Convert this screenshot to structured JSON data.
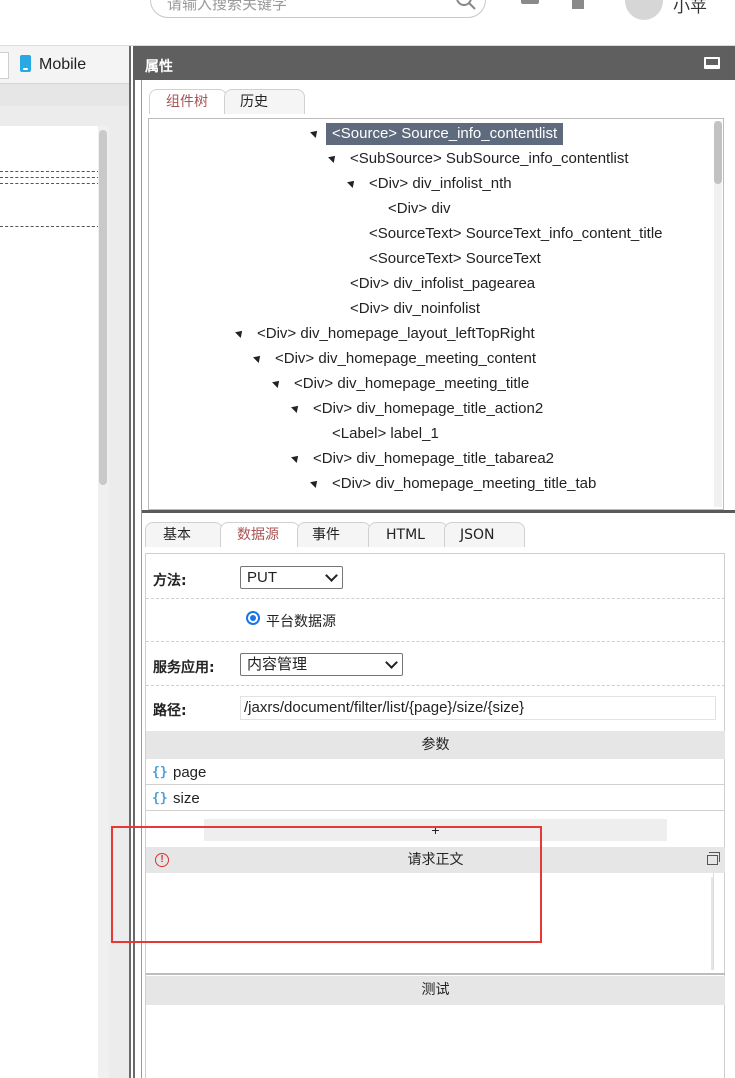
{
  "topbar": {
    "search_placeholder": "请输入搜索关键字",
    "username": "小苹"
  },
  "left_pane": {
    "device_tab": "Mobile"
  },
  "panel": {
    "title": "属性",
    "top_tabs": [
      "组件树",
      "历史"
    ],
    "active_top_tab": "组件树",
    "tree": [
      {
        "tag": "<Source>",
        "name": "Source_info_contentlist",
        "expanded": true,
        "selected": true
      },
      {
        "tag": "<SubSource>",
        "name": "SubSource_info_contentlist",
        "expanded": true
      },
      {
        "tag": "<Div>",
        "name": "div_infolist_nth",
        "expanded": true
      },
      {
        "tag": "<Div>",
        "name": "div"
      },
      {
        "tag": "<SourceText>",
        "name": "SourceText_info_content_title"
      },
      {
        "tag": "<SourceText>",
        "name": "SourceText"
      },
      {
        "tag": "<Div>",
        "name": "div_infolist_pagearea"
      },
      {
        "tag": "<Div>",
        "name": "div_noinfolist"
      },
      {
        "tag": "<Div>",
        "name": "div_homepage_layout_leftTopRight",
        "expanded": true
      },
      {
        "tag": "<Div>",
        "name": "div_homepage_meeting_content",
        "expanded": true
      },
      {
        "tag": "<Div>",
        "name": "div_homepage_meeting_title",
        "expanded": true
      },
      {
        "tag": "<Div>",
        "name": "div_homepage_title_action2",
        "expanded": true
      },
      {
        "tag": "<Label>",
        "name": "label_1"
      },
      {
        "tag": "<Div>",
        "name": "div_homepage_title_tabarea2",
        "expanded": true
      },
      {
        "tag": "<Div>",
        "name": "div_homepage_meeting_title_tab",
        "expanded": true
      }
    ],
    "bottom_tabs": [
      "基本",
      "数据源",
      "事件",
      "HTML",
      "JSON"
    ],
    "active_bottom_tab": "数据源",
    "form": {
      "method_label": "方法:",
      "method_value": "PUT",
      "radio_label": "平台数据源",
      "service_label": "服务应用:",
      "service_value": "内容管理",
      "path_label": "路径:",
      "path_value": "/jaxrs/document/filter/list/{page}/size/{size}"
    },
    "params": {
      "header": "参数",
      "items": [
        "page",
        "size"
      ],
      "add_label": "+"
    },
    "request_body": {
      "header": "请求正文"
    },
    "test": {
      "header": "测试"
    },
    "colors": {
      "header_bg": "#5f5f5f",
      "active_tab_text": "#a85454",
      "selected_node_bg": "#5e6a7d",
      "annotation_red": "#e53935",
      "brace_icon": "#4a9fd8"
    }
  }
}
